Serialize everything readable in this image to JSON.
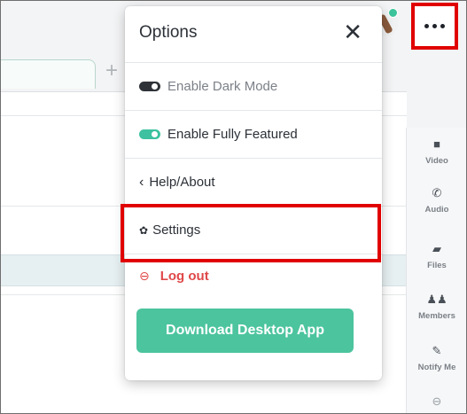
{
  "options_menu": {
    "title": "Options",
    "close_glyph": "✕",
    "items": [
      {
        "label": "Enable Dark Mode",
        "icon": "toggle-off-icon",
        "state": "off"
      },
      {
        "label": "Enable Fully Featured",
        "icon": "toggle-on-icon",
        "state": "on"
      },
      {
        "label": "Help/About",
        "icon": "chevron-left-icon",
        "glyph": "‹"
      },
      {
        "label": "Settings",
        "icon": "gear-icon",
        "glyph": "✿"
      },
      {
        "label": "Log out",
        "icon": "logout-icon",
        "glyph": "⊖"
      }
    ],
    "download_button": "Download Desktop App"
  },
  "tabs": {
    "add_glyph": "+"
  },
  "right_rail": [
    {
      "label": "Video",
      "icon": "video-icon",
      "glyph": "■"
    },
    {
      "label": "Audio",
      "icon": "phone-icon",
      "glyph": "✆"
    },
    {
      "label": "Files",
      "icon": "folder-icon",
      "glyph": "▰"
    },
    {
      "label": "Members",
      "icon": "members-icon",
      "glyph": "♟♟"
    },
    {
      "label": "Notify Me",
      "icon": "bell-off-icon",
      "glyph": "✎"
    },
    {
      "label": "",
      "icon": "logout-icon",
      "glyph": "⊖"
    }
  ],
  "colors": {
    "accent_green": "#4cc49e",
    "highlight_red": "#e00000",
    "logout_red": "#e04848"
  }
}
